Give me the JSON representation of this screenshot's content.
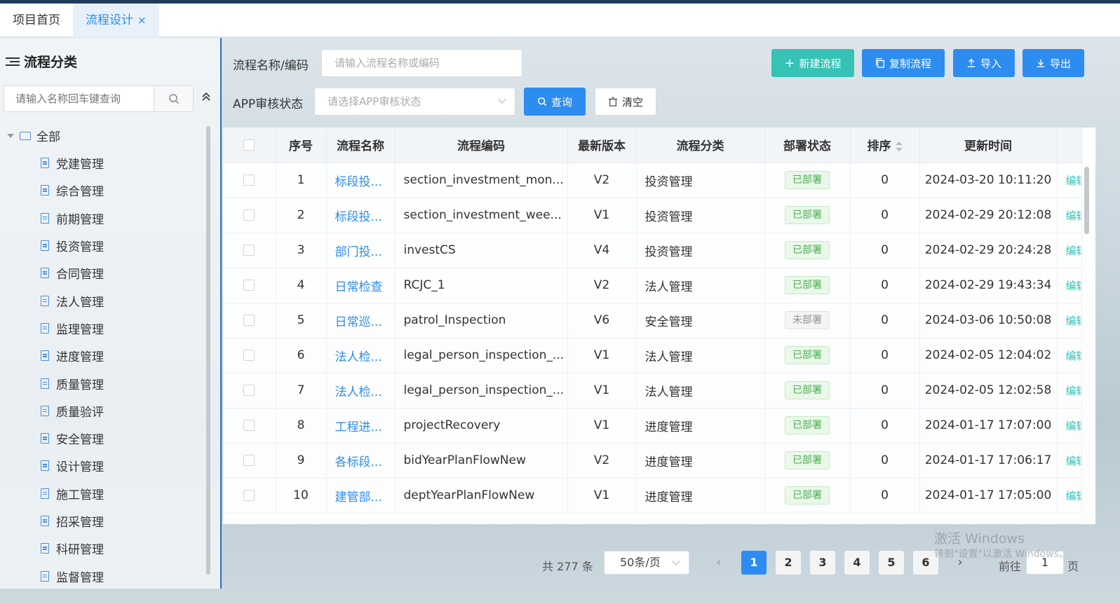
{
  "tabs": [
    {
      "label": "项目首页"
    },
    {
      "label": "流程设计",
      "close": "×"
    }
  ],
  "sidebar": {
    "title": "流程分类",
    "search_placeholder": "请输入名称回车键查询",
    "root": "全部",
    "items": [
      "党建管理",
      "综合管理",
      "前期管理",
      "投资管理",
      "合同管理",
      "法人管理",
      "监理管理",
      "进度管理",
      "质量管理",
      "质量验评",
      "安全管理",
      "设计管理",
      "施工管理",
      "招采管理",
      "科研管理",
      "监督管理"
    ]
  },
  "filters": {
    "name_label": "流程名称/编码",
    "name_placeholder": "请输入流程名称或编码",
    "app_label": "APP审核状态",
    "app_placeholder": "请选择APP审核状态",
    "query_btn": "查询",
    "clear_btn": "清空"
  },
  "actions": {
    "new_btn": "新建流程",
    "copy_btn": "复制流程",
    "import_btn": "导入",
    "export_btn": "导出"
  },
  "table": {
    "headers": [
      "序号",
      "流程名称",
      "流程编码",
      "最新版本",
      "流程分类",
      "部署状态",
      "排序",
      "更新时间"
    ],
    "rows": [
      {
        "no": "1",
        "name": "标段投...",
        "code": "section_investment_mon...",
        "version": "V2",
        "category": "投资管理",
        "status": "已部署",
        "order": "0",
        "updated": "2024-03-20 10:11:20",
        "action": "编辑"
      },
      {
        "no": "2",
        "name": "标段投...",
        "code": "section_investment_wee...",
        "version": "V1",
        "category": "投资管理",
        "status": "已部署",
        "order": "0",
        "updated": "2024-02-29 20:12:08",
        "action": "编辑"
      },
      {
        "no": "3",
        "name": "部门投...",
        "code": "investCS",
        "version": "V4",
        "category": "投资管理",
        "status": "已部署",
        "order": "0",
        "updated": "2024-02-29 20:24:28",
        "action": "编辑"
      },
      {
        "no": "4",
        "name": "日常检查",
        "code": "RCJC_1",
        "version": "V2",
        "category": "法人管理",
        "status": "已部署",
        "order": "0",
        "updated": "2024-02-29 19:43:34",
        "action": "编辑"
      },
      {
        "no": "5",
        "name": "日常巡...",
        "code": "patrol_Inspection",
        "version": "V6",
        "category": "安全管理",
        "status": "未部署",
        "order": "0",
        "updated": "2024-03-06 10:50:08",
        "action": "编辑"
      },
      {
        "no": "6",
        "name": "法人检...",
        "code": "legal_person_inspection_...",
        "version": "V1",
        "category": "法人管理",
        "status": "已部署",
        "order": "0",
        "updated": "2024-02-05 12:04:02",
        "action": "编辑"
      },
      {
        "no": "7",
        "name": "法人检...",
        "code": "legal_person_inspection_...",
        "version": "V1",
        "category": "法人管理",
        "status": "已部署",
        "order": "0",
        "updated": "2024-02-05 12:02:58",
        "action": "编辑"
      },
      {
        "no": "8",
        "name": "工程进...",
        "code": "projectRecovery",
        "version": "V1",
        "category": "进度管理",
        "status": "已部署",
        "order": "0",
        "updated": "2024-01-17 17:07:00",
        "action": "编辑"
      },
      {
        "no": "9",
        "name": "各标段...",
        "code": "bidYearPlanFlowNew",
        "version": "V2",
        "category": "进度管理",
        "status": "已部署",
        "order": "0",
        "updated": "2024-01-17 17:06:17",
        "action": "编辑"
      },
      {
        "no": "10",
        "name": "建管部...",
        "code": "deptYearPlanFlowNew",
        "version": "V1",
        "category": "进度管理",
        "status": "已部署",
        "order": "0",
        "updated": "2024-01-17 17:05:00",
        "action": "编辑"
      }
    ]
  },
  "pagination": {
    "total": "共 277 条",
    "page_size": "50条/页",
    "pages": [
      "1",
      "2",
      "3",
      "4",
      "5",
      "6"
    ],
    "current": "1",
    "goto_label": "前往",
    "goto_value": "1",
    "goto_suffix": "页"
  },
  "watermark": {
    "line1": "激活 Windows",
    "line2": "转到\"设置\"以激活 Windows。"
  },
  "colors": {
    "primary": "#2d8cf0",
    "teal": "#36c2b5",
    "deployed": "#4caf50"
  }
}
